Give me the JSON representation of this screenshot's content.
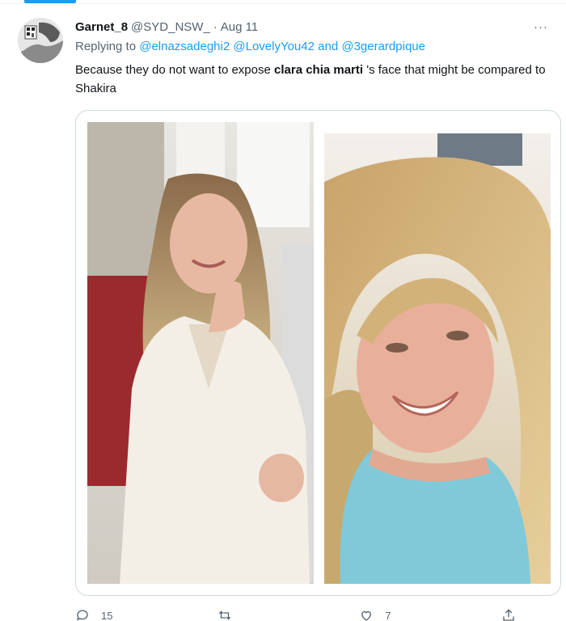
{
  "tweet": {
    "display_name": "Garnet_8",
    "handle": "@SYD_NSW_",
    "separator": "·",
    "date": "Aug 11",
    "more_label": "···",
    "replying_prefix": "Replying to",
    "replying_to": [
      {
        "text": "@elnazsadeghi2"
      },
      {
        "text": "@LovelyYou42"
      },
      {
        "text": "and"
      },
      {
        "text": "@3gerardpique"
      }
    ],
    "text_before": "Because they do not want to expose ",
    "text_bold": "clara chia marti",
    "text_after": " 's face that might be compared to Shakira"
  },
  "actions": {
    "reply_count": "15",
    "retweet_count": "",
    "like_count": "7",
    "share_count": ""
  },
  "colors": {
    "accent": "#1d9bf0",
    "muted": "#536471",
    "text": "#0f1419",
    "border": "#cfd9de"
  },
  "icons": {
    "reply": "speech-bubble-icon",
    "retweet": "retweet-icon",
    "like": "heart-icon",
    "share": "share-icon",
    "more": "ellipsis-icon"
  }
}
